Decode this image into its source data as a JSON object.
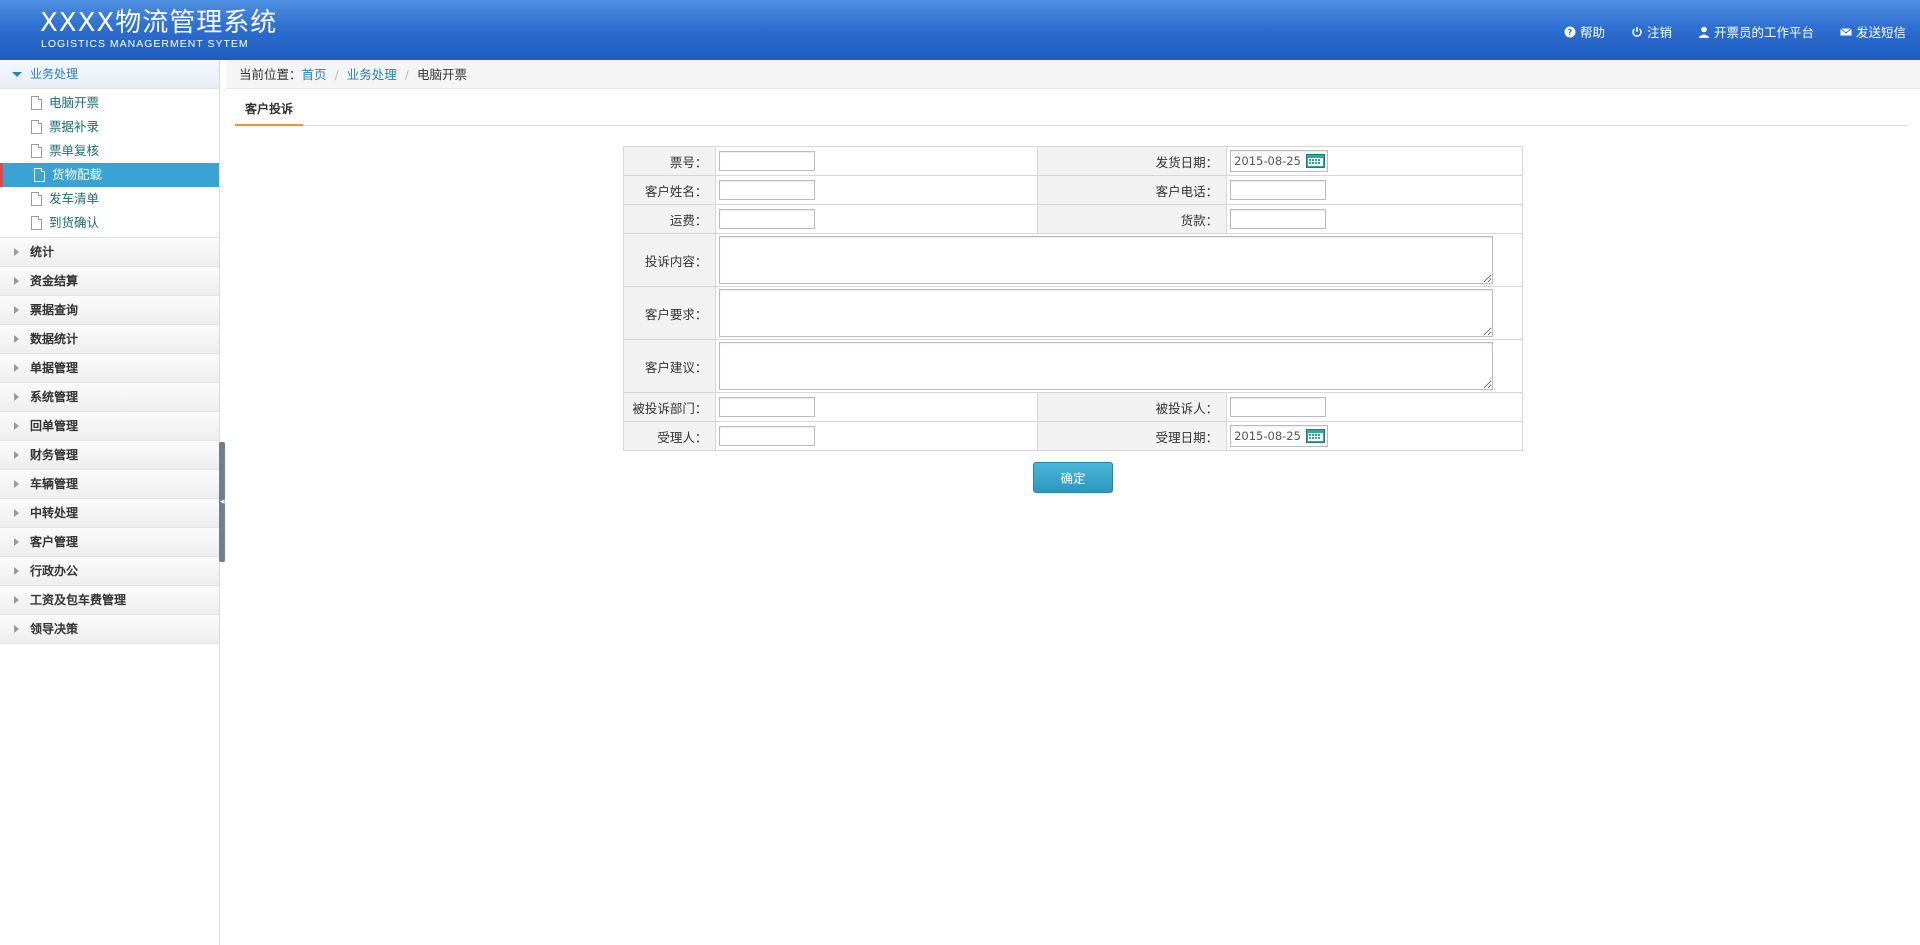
{
  "header": {
    "title": "XXXX物流管理系统",
    "subtitle": "LOGISTICS MANAGERMENT SYTEM",
    "links": [
      {
        "label": "帮助",
        "icon": "help-icon"
      },
      {
        "label": "注销",
        "icon": "power-icon"
      },
      {
        "label": "开票员的工作平台",
        "icon": "user-icon"
      },
      {
        "label": "发送短信",
        "icon": "envelope-icon"
      }
    ]
  },
  "sidebar": {
    "open_group": "业务处理",
    "open_items": [
      "电脑开票",
      "票据补录",
      "票单复核",
      "货物配载",
      "发车清单",
      "到货确认"
    ],
    "active_item": "货物配载",
    "groups": [
      "统计",
      "资金结算",
      "票据查询",
      "数据统计",
      "单据管理",
      "系统管理",
      "回单管理",
      "财务管理",
      "车辆管理",
      "中转处理",
      "客户管理",
      "行政办公",
      "工资及包车费管理",
      "领导决策"
    ]
  },
  "breadcrumb": {
    "prefix": "当前位置：",
    "home": "首页",
    "section": "业务处理",
    "current": "电脑开票"
  },
  "tab": {
    "label": "客户投诉"
  },
  "form": {
    "ticket_no_label": "票号：",
    "ship_date_label": "发货日期：",
    "ship_date_value": "2015-08-25",
    "customer_name_label": "客户姓名：",
    "customer_phone_label": "客户电话：",
    "freight_label": "运费：",
    "payment_label": "货款：",
    "complaint_content_label": "投诉内容：",
    "customer_request_label": "客户要求：",
    "customer_suggestion_label": "客户建议：",
    "complained_dept_label": "被投诉部门：",
    "complained_person_label": "被投诉人：",
    "handler_label": "受理人：",
    "handle_date_label": "受理日期：",
    "handle_date_value": "2015-08-25"
  },
  "actions": {
    "confirm": "确定"
  },
  "colors": {
    "header_blue": "#2e6fd1",
    "active_item_bg": "#3aa2d4",
    "active_item_marker": "#e3474a",
    "link_blue": "#2a7ec4",
    "tab_underline": "#ff8c26",
    "button": "#2c97bf"
  }
}
